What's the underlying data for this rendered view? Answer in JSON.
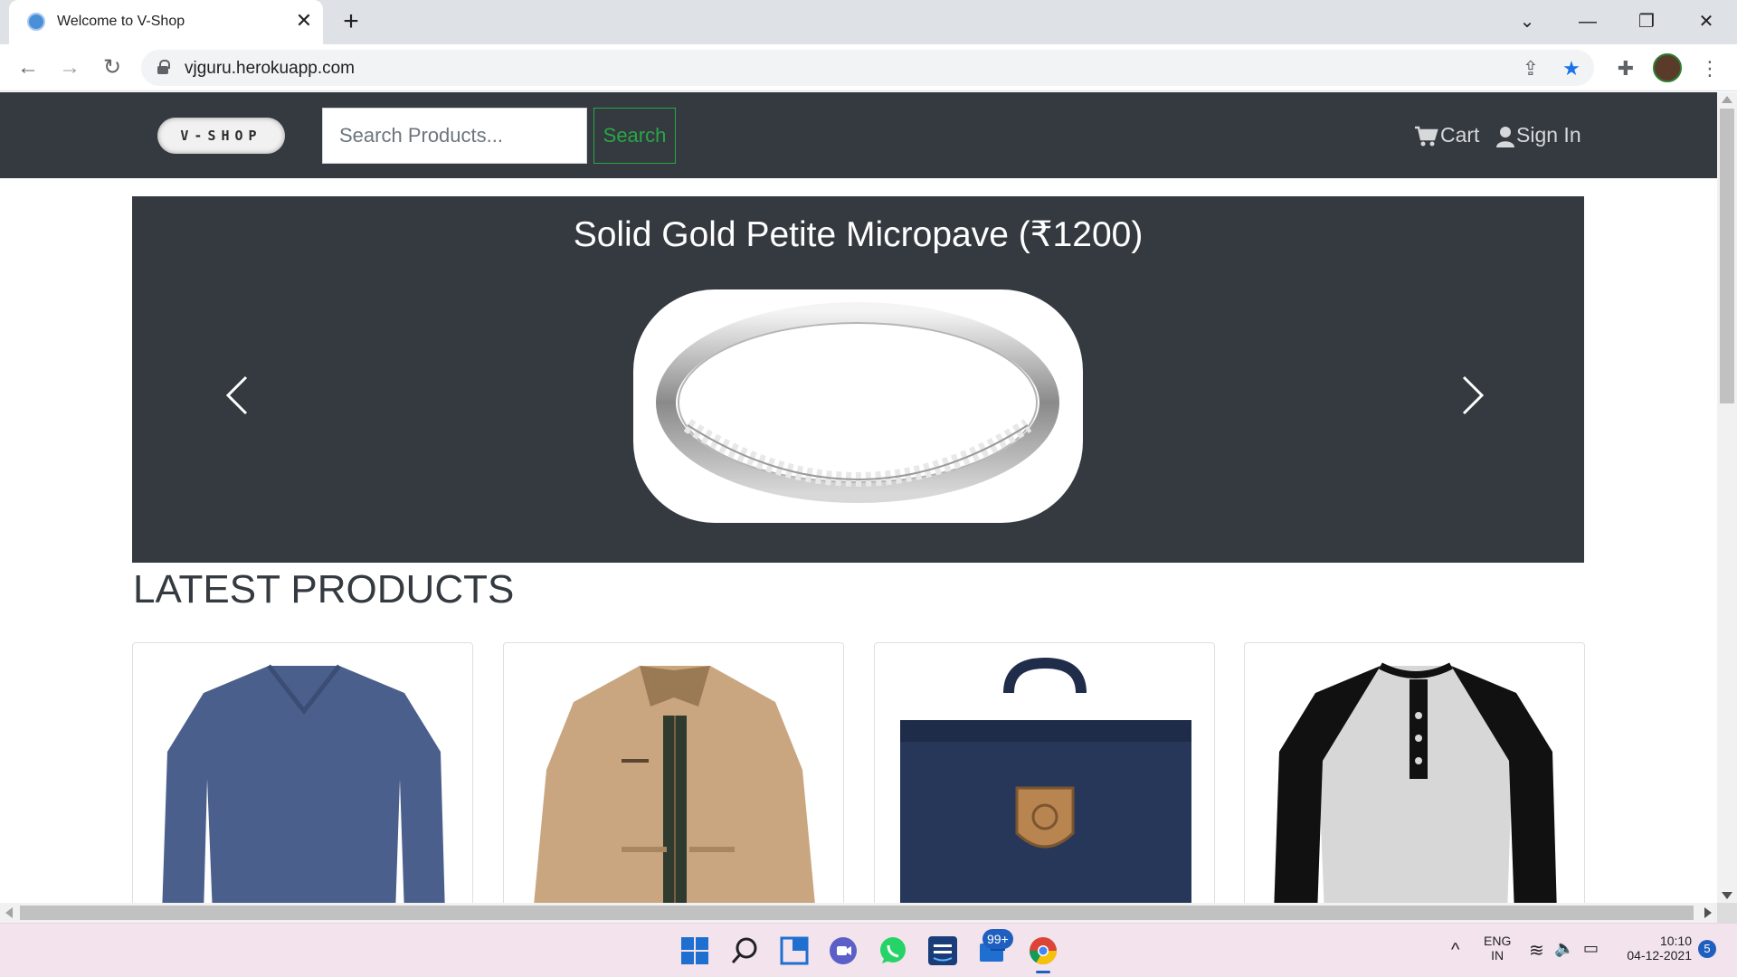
{
  "browser": {
    "tab_title": "Welcome to V-Shop",
    "url": "vjguru.herokuapp.com",
    "icons": [
      "favicon",
      "close-icon",
      "plus-icon",
      "chevron-down-icon",
      "minimize-icon",
      "restore-icon",
      "window-close-icon",
      "back-arrow-icon",
      "forward-arrow-icon",
      "reload-icon",
      "lock-icon",
      "share-icon",
      "star-icon",
      "puzzle-icon",
      "kebab-menu-icon"
    ]
  },
  "site": {
    "logo_text": "V-SHOP",
    "search_placeholder": "Search Products...",
    "search_button": "Search",
    "cart_label": "Cart",
    "signin_label": "Sign In"
  },
  "carousel": {
    "caption": "Solid Gold Petite Micropave (₹1200)",
    "image": "silver ring with micropave diamonds"
  },
  "latest": {
    "title": "LATEST PRODUCTS",
    "products": [
      {
        "image": "blue v-neck long sleeve t-shirt"
      },
      {
        "image": "khaki jacket"
      },
      {
        "image": "navy blue backpack"
      },
      {
        "image": "raglan henley shirt"
      }
    ]
  },
  "taskbar": {
    "apps": [
      "windows-start",
      "search",
      "widgets",
      "teams-chat",
      "whatsapp",
      "prime-video",
      "mail",
      "chrome"
    ],
    "mail_badge": "99+",
    "lang_line1": "ENG",
    "lang_line2": "IN",
    "time": "10:10",
    "date": "04-12-2021",
    "notifications": "5"
  },
  "colors": {
    "navbar": "#343a40",
    "search_green": "#28a745",
    "tabstrip": "#dee1e6",
    "taskbar": "#f3e3ec"
  }
}
